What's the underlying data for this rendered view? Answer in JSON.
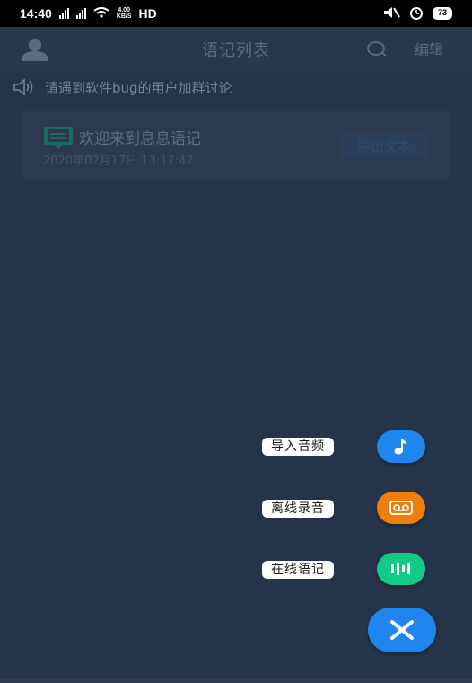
{
  "status_bar": {
    "time": "14:40",
    "net_speed_value": "4.00",
    "net_speed_unit": "KB/S",
    "network_label": "HD",
    "battery": "73"
  },
  "header": {
    "title": "语记列表",
    "edit_label": "编辑"
  },
  "notice": {
    "text": "请遇到软件bug的用户加群讨论"
  },
  "notes": [
    {
      "title": "欢迎来到息息语记",
      "time": "2020年02月17日 13:17:47",
      "export_label": "导出文本"
    }
  ],
  "fab_menu": {
    "import_label": "导入音频",
    "offline_label": "离线录音",
    "online_label": "在线语记",
    "colors": {
      "import": "#1f86f0",
      "offline": "#ef7d0a",
      "online": "#12c985",
      "close": "#1f86f0"
    }
  },
  "icons": {
    "avatar": "person-icon",
    "search": "search-icon",
    "speaker": "speaker-icon",
    "note": "note-icon",
    "music": "music-note-icon",
    "voicemail": "voicemail-icon",
    "waveform": "waveform-icon",
    "close": "close-icon"
  }
}
